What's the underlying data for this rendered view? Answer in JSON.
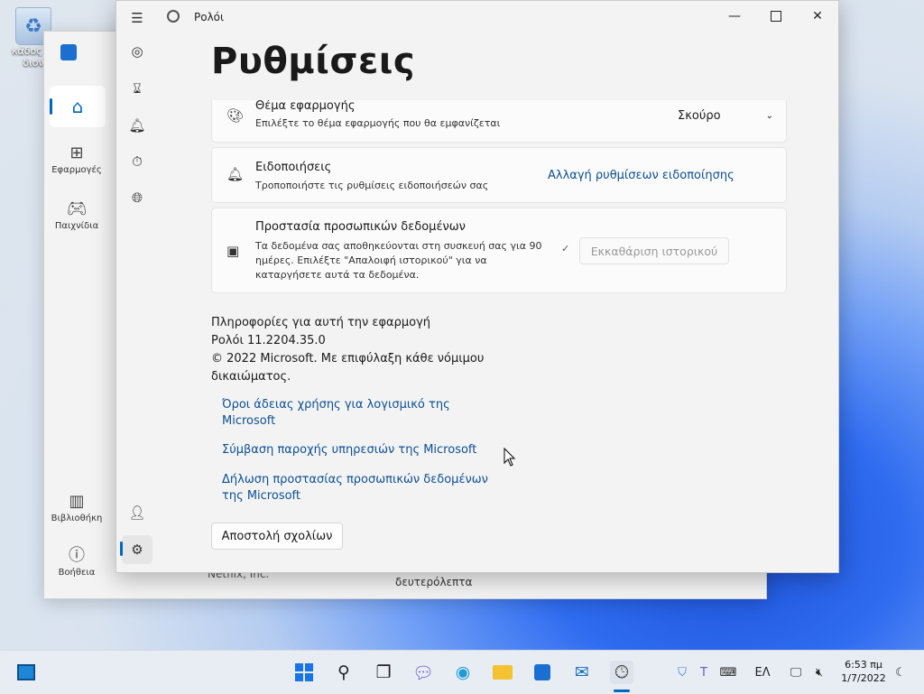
{
  "desktop": {
    "recycle_label_line1": "κάδος σι",
    "recycle_label_line2": "διον"
  },
  "store": {
    "nav": {
      "apps": "Εφαρμογές",
      "games": "Παιχνίδια",
      "library": "Βιβλιοθήκη",
      "help": "Βοήθεια"
    },
    "peek_left": "Netflix, Inc.",
    "peek_center": "δευτερόλεπτα"
  },
  "window": {
    "title": "Ρολόι"
  },
  "settings": {
    "page_title": "Ρυθμίσεις",
    "theme": {
      "title": "Θέμα εφαρμογής",
      "desc": "Επιλέξτε το θέμα εφαρμογής που θα εμφανίζεται",
      "value": "Σκούρο"
    },
    "notifications": {
      "title": "Ειδοποιήσεις",
      "desc": "Τροποποιήστε τις ρυθμίσεις ειδοποιήσεών σας",
      "link": "Αλλαγή ρυθμίσεων ειδοποίησης"
    },
    "privacy": {
      "title": "Προστασία προσωπικών δεδομένων",
      "desc_line1": "Τα δεδομένα σας αποθηκεύονται στη συσκευή σας για 90",
      "desc_line2": "ημέρες. Επιλέξτε \"Απαλοιφή ιστορικού\" για να",
      "desc_line3": "καταργήσετε αυτά τα δεδομένα.",
      "button": "Εκκαθάριση ιστορικού"
    },
    "about": {
      "heading": "Πληροφορίες για αυτή την εφαρμογή",
      "version": "Ρολόι 11.2204.35.0",
      "copyright_line1": "© 2022 Microsoft. Με επιφύλαξη κάθε νόμιμου",
      "copyright_line2": "δικαιώματος.",
      "link_license_line1": "Όροι άδειας χρήσης για λογισμικό της",
      "link_license_line2": "Microsoft",
      "link_services": "Σύμβαση παροχής υπηρεσιών της Microsoft",
      "link_privacy_line1": "Δήλωση προστασίας προσωπικών δεδομένων",
      "link_privacy_line2": "της Microsoft"
    },
    "feedback_button": "Αποστολή σχολίων"
  },
  "taskbar": {
    "language": "ΕΛ",
    "time": "6:53 πμ",
    "date": "1/7/2022"
  },
  "colors": {
    "accent": "#0067c0",
    "link": "#0b4f94"
  }
}
